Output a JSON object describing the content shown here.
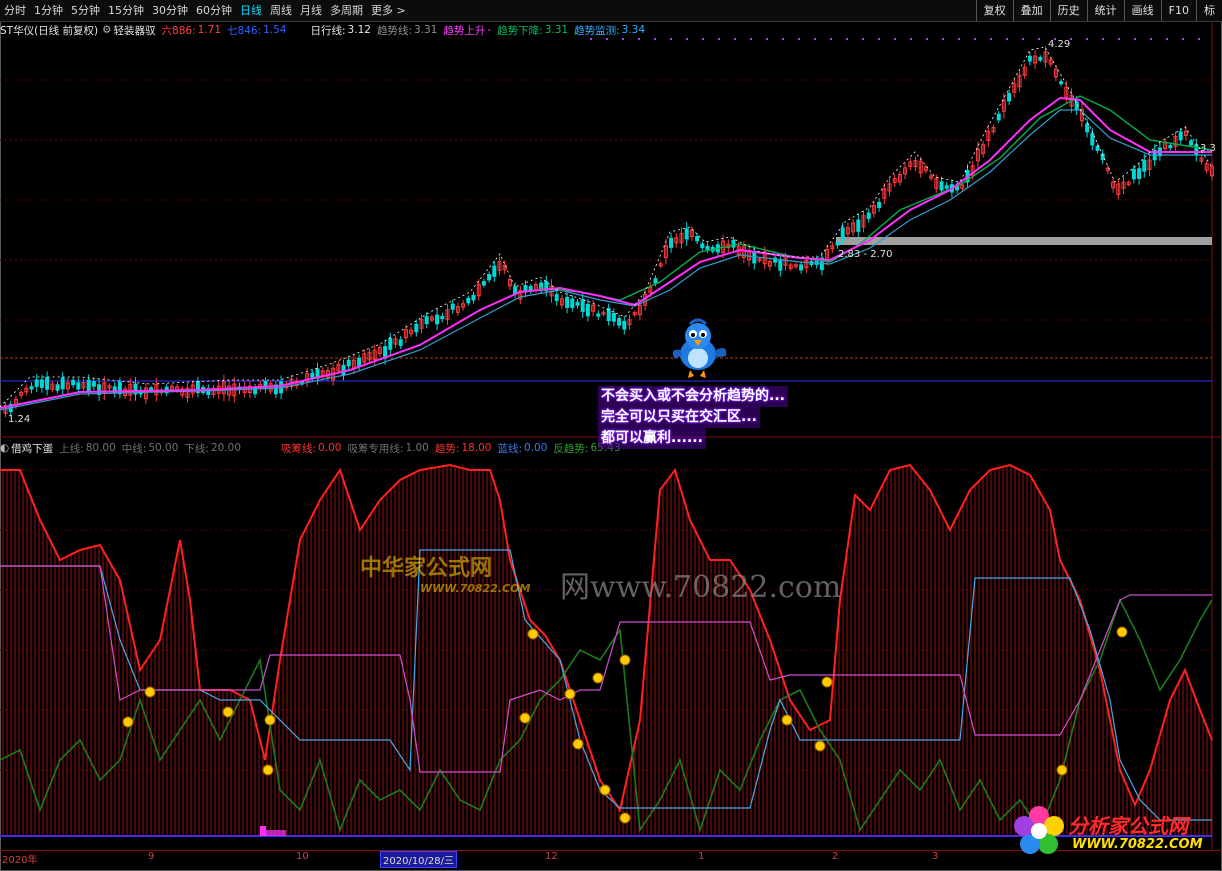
{
  "toolbar": {
    "periods": [
      "分时",
      "1分钟",
      "5分钟",
      "15分钟",
      "30分钟",
      "60分钟",
      "日线",
      "周线",
      "月线",
      "多周期",
      "更多"
    ],
    "active": "日线",
    "more_arrow": ">",
    "right_buttons": [
      "复权",
      "叠加",
      "历史",
      "统计",
      "画线",
      "F10",
      "标"
    ]
  },
  "main_legend": {
    "stock": "ST华仪(日线 前复权)",
    "indicator": "轻装器驭",
    "l1_label": "六886:",
    "l1_value": "1.71",
    "l2_label": "七846:",
    "l2_value": "1.54",
    "daily_label": "日行线:",
    "daily_value": "3.12",
    "trend_label": "趋势线:",
    "trend_value": "3.31",
    "up_label": "趋势上升",
    "up_value": "-",
    "down_label": "趋势下降:",
    "down_value": "3.31",
    "monitor_label": "趋势监测:",
    "monitor_value": "3.34"
  },
  "price_labels": {
    "high": "4.29",
    "low": "1.24",
    "range": "2.83 - 2.70",
    "right": "3.3"
  },
  "bubble": {
    "line1": "不会买入或不会分析趋势的...",
    "line2": "完全可以只买在交汇区...",
    "line3": "都可以赢利......"
  },
  "sub_legend": {
    "name": "借鸡下蛋",
    "upper_label": "上线:",
    "upper_value": "80.00",
    "mid_label": "中线:",
    "mid_value": "50.00",
    "lower_label": "下线:",
    "lower_value": "20.00",
    "chip_label": "吸筹线:",
    "chip_value": "0.00",
    "chip_spec_label": "吸筹专用线:",
    "chip_spec_value": "1.00",
    "trend_label": "趋势:",
    "trend_value": "18.00",
    "blue_label": "蓝线:",
    "blue_value": "0.00",
    "rev_label": "反趋势:",
    "rev_value": "65.43"
  },
  "axis": {
    "labels": [
      "2020年",
      "9",
      "10",
      "2020/10/28/三",
      "12",
      "1",
      "2",
      "3"
    ]
  },
  "watermarks": {
    "cn": "中华家公式网",
    "url_small": "WWW.70822.COM",
    "url": "网www.70822.com",
    "logo_cn": "分析家公式网",
    "logo_url": "WWW.70822.COM"
  },
  "colors": {
    "up": "#ff3b3b",
    "down": "#00d8d8",
    "ma_pink": "#ff30ff",
    "ma_green": "#00b050",
    "red_line": "#ff2020",
    "cyan_line": "#4aa8e8",
    "green_line": "#1e7a1e",
    "magenta_line": "#d050d0"
  }
}
